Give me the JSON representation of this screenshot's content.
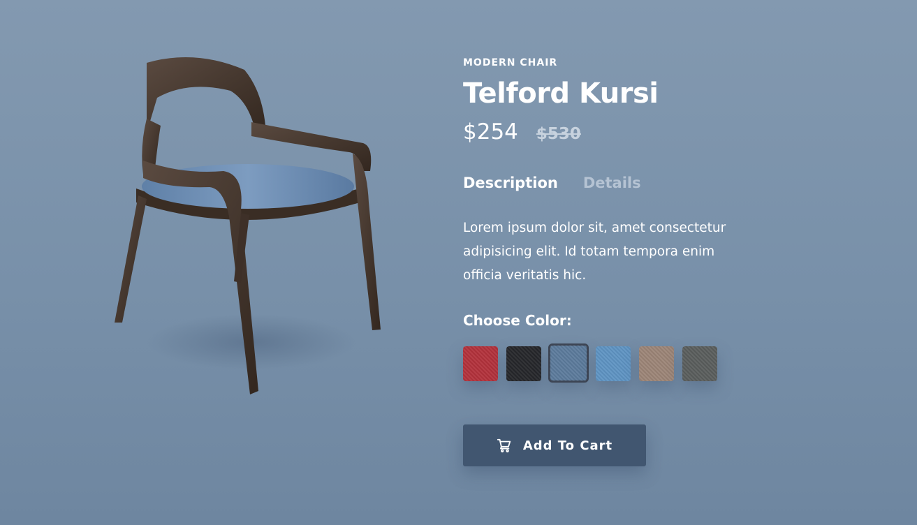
{
  "product": {
    "category": "MODERN CHAIR",
    "title": "Telford Kursi",
    "price": "$254",
    "old_price": "$530",
    "image_alt": "Wooden chair with blue velvet seat"
  },
  "tabs": [
    {
      "label": "Description",
      "active": true
    },
    {
      "label": "Details",
      "active": false
    }
  ],
  "description": "Lorem ipsum dolor sit, amet consectetur adipisicing elit. Id totam tempora enim officia veritatis hic.",
  "color_picker": {
    "label": "Choose Color:",
    "swatches": [
      {
        "name": "red",
        "color": "#b3323c",
        "selected": false
      },
      {
        "name": "black",
        "color": "#26272b",
        "selected": false
      },
      {
        "name": "blue-velvet",
        "color": "#5c7b9c",
        "selected": true
      },
      {
        "name": "light-blue",
        "color": "#5f94c3",
        "selected": false
      },
      {
        "name": "beige",
        "color": "#9c8577",
        "selected": false
      },
      {
        "name": "gray",
        "color": "#5a5e5d",
        "selected": false
      }
    ]
  },
  "cta": {
    "label": "Add To Cart",
    "icon": "cart-icon"
  }
}
